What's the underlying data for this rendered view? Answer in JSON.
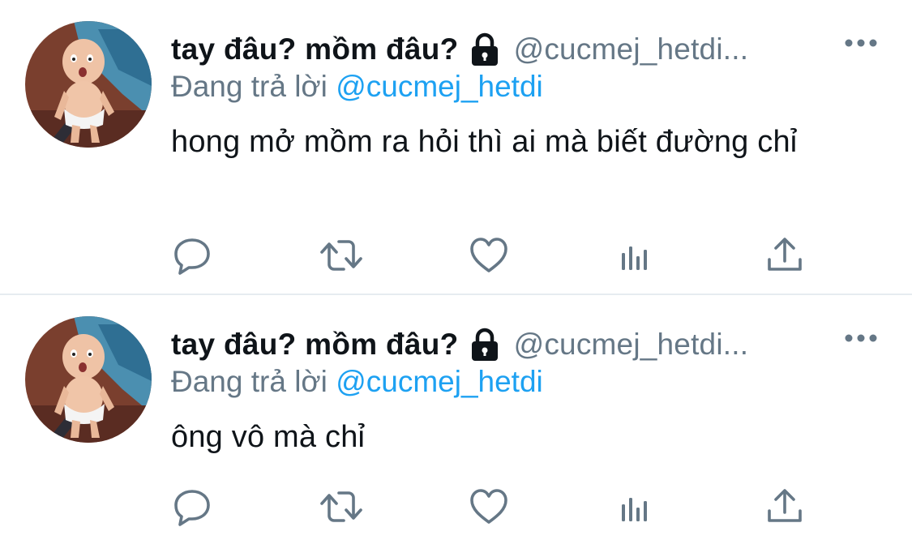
{
  "tweets": [
    {
      "display_name": "tay đâu? mồm đâu?",
      "handle": "@cucmej_hetdi...",
      "reply_prefix": "Đang trả lời",
      "reply_to": "@cucmej_hetdi",
      "text": "hong mở mồm ra hỏi thì ai mà biết đường chỉ"
    },
    {
      "display_name": "tay đâu? mồm đâu?",
      "handle": "@cucmej_hetdi...",
      "reply_prefix": "Đang trả lời",
      "reply_to": "@cucmej_hetdi",
      "text": "ông vô mà chỉ"
    }
  ],
  "icons": {
    "header": [
      "lock-icon",
      "more-icon"
    ],
    "actions": [
      "reply-icon",
      "retweet-icon",
      "like-icon",
      "stats-icon",
      "share-icon"
    ]
  },
  "colors": {
    "text_primary": "#0f1419",
    "text_secondary": "#657786",
    "link_blue": "#1da1f2",
    "icon_gray": "#657786",
    "divider": "#e6ecf0"
  }
}
